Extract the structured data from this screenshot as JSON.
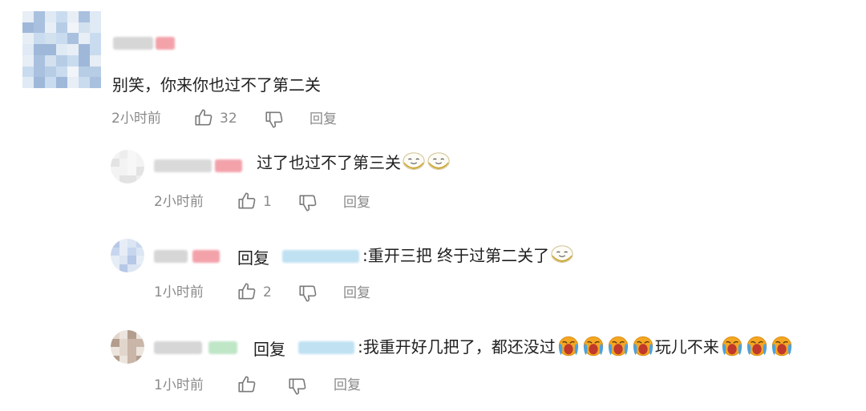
{
  "comments": [
    {
      "text": "别笑，你来你也过不了第二关",
      "time": "2小时前",
      "likes": "32",
      "reply_label": "回复"
    }
  ],
  "replies": [
    {
      "text": "过了也过不了第三关",
      "time": "2小时前",
      "likes": "1",
      "reply_label": "回复",
      "emoji": [
        "laughing-emoji",
        "laughing-emoji"
      ]
    },
    {
      "reply_word": "回复",
      "text": ":重开三把 终于过第二关了",
      "time": "1小时前",
      "likes": "2",
      "reply_label": "回复",
      "emoji": [
        "laughing-emoji"
      ]
    },
    {
      "reply_word": "回复",
      "text_before": ":我重开好几把了，都还没过",
      "text_after": "玩儿不来",
      "time": "1小时前",
      "reply_label": "回复",
      "emoji_before": [
        "crying-emoji",
        "crying-emoji",
        "crying-emoji",
        "crying-emoji"
      ],
      "emoji_after": [
        "crying-emoji",
        "crying-emoji",
        "crying-emoji"
      ]
    }
  ],
  "colors": {
    "meta_gray": "#8a8a8a",
    "text": "#1f1f1f",
    "blur_pink": "#f3a2aa",
    "blur_blue": "#bfe1f2",
    "blur_green": "#bfe6c7"
  }
}
